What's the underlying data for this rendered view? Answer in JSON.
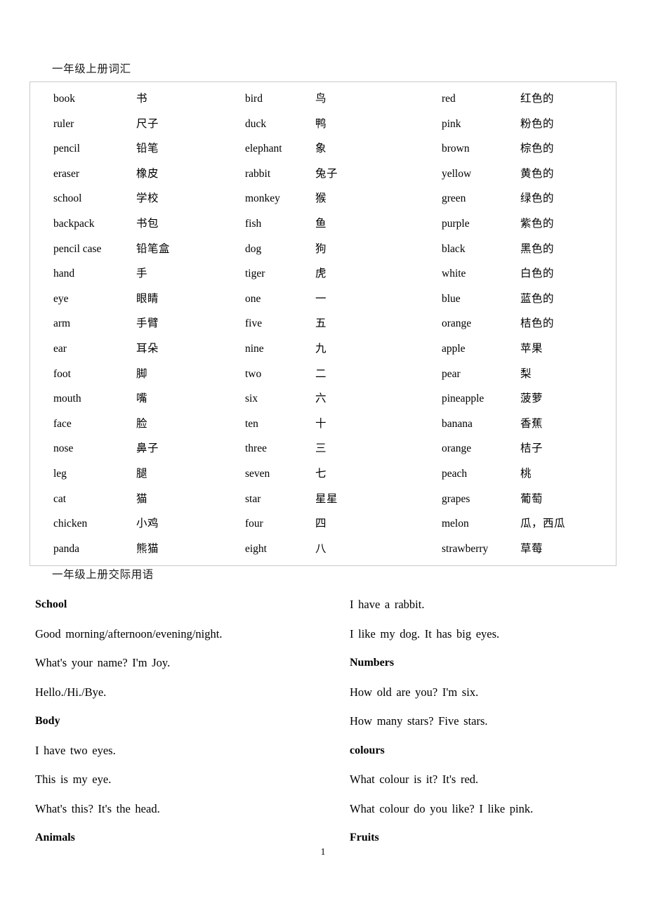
{
  "document": {
    "vocab_heading": "一年级上册词汇",
    "phrases_heading": "一年级上册交际用语",
    "page_number": "1"
  },
  "vocabulary": {
    "columns": [
      {
        "name": "column-1",
        "rows": [
          {
            "en": "book",
            "cn": "书"
          },
          {
            "en": "ruler",
            "cn": "尺子"
          },
          {
            "en": "pencil",
            "cn": "铅笔"
          },
          {
            "en": "eraser",
            "cn": "橡皮"
          },
          {
            "en": "school",
            "cn": "学校"
          },
          {
            "en": "backpack",
            "cn": "书包"
          },
          {
            "en": "pencil case",
            "cn": "铅笔盒"
          },
          {
            "en": "hand",
            "cn": "手"
          },
          {
            "en": "eye",
            "cn": "眼睛"
          },
          {
            "en": "arm",
            "cn": "手臂"
          },
          {
            "en": "ear",
            "cn": "耳朵"
          },
          {
            "en": "foot",
            "cn": "脚"
          },
          {
            "en": "mouth",
            "cn": "嘴"
          },
          {
            "en": "face",
            "cn": "脸"
          },
          {
            "en": "nose",
            "cn": "鼻子"
          },
          {
            "en": "leg",
            "cn": "腿"
          },
          {
            "en": "cat",
            "cn": "猫"
          },
          {
            "en": "chicken",
            "cn": "小鸡"
          },
          {
            "en": "panda",
            "cn": "熊猫"
          }
        ]
      },
      {
        "name": "column-2",
        "rows": [
          {
            "en": "bird",
            "cn": "鸟"
          },
          {
            "en": "duck",
            "cn": "鸭"
          },
          {
            "en": "elephant",
            "cn": "象"
          },
          {
            "en": "rabbit",
            "cn": "兔子"
          },
          {
            "en": "monkey",
            "cn": "猴"
          },
          {
            "en": "fish",
            "cn": "鱼"
          },
          {
            "en": "dog",
            "cn": "狗"
          },
          {
            "en": "tiger",
            "cn": "虎"
          },
          {
            "en": "one",
            "cn": "一"
          },
          {
            "en": "five",
            "cn": "五"
          },
          {
            "en": "nine",
            "cn": "九"
          },
          {
            "en": "two",
            "cn": "二"
          },
          {
            "en": "six",
            "cn": "六"
          },
          {
            "en": "ten",
            "cn": "十"
          },
          {
            "en": "three",
            "cn": "三"
          },
          {
            "en": "seven",
            "cn": "七"
          },
          {
            "en": "star",
            "cn": "星星"
          },
          {
            "en": "four",
            "cn": "四"
          },
          {
            "en": "eight",
            "cn": "八"
          }
        ]
      },
      {
        "name": "column-3",
        "rows": [
          {
            "en": "red",
            "cn": "红色的"
          },
          {
            "en": "pink",
            "cn": "粉色的"
          },
          {
            "en": "brown",
            "cn": "棕色的"
          },
          {
            "en": "yellow",
            "cn": "黄色的"
          },
          {
            "en": "green",
            "cn": "绿色的"
          },
          {
            "en": "purple",
            "cn": "紫色的"
          },
          {
            "en": "black",
            "cn": "黑色的"
          },
          {
            "en": "white",
            "cn": "白色的"
          },
          {
            "en": "blue",
            "cn": "蓝色的"
          },
          {
            "en": "orange",
            "cn": "桔色的"
          },
          {
            "en": "apple",
            "cn": "苹果"
          },
          {
            "en": "pear",
            "cn": "梨"
          },
          {
            "en": "pineapple",
            "cn": "菠萝"
          },
          {
            "en": "banana",
            "cn": "香蕉"
          },
          {
            "en": "orange",
            "cn": "桔子"
          },
          {
            "en": "peach",
            "cn": "桃"
          },
          {
            "en": "grapes",
            "cn": "葡萄"
          },
          {
            "en": "melon",
            "cn": "瓜，西瓜"
          },
          {
            "en": "strawberry",
            "cn": "草莓"
          }
        ]
      }
    ]
  },
  "phrases": {
    "left_column": [
      {
        "type": "head",
        "text": "School"
      },
      {
        "type": "sent",
        "text": "Good morning/afternoon/evening/night."
      },
      {
        "type": "sent",
        "text": "What's your name? I'm Joy."
      },
      {
        "type": "sent",
        "text": "Hello./Hi./Bye."
      },
      {
        "type": "head",
        "text": "Body"
      },
      {
        "type": "sent",
        "text": "I have two eyes."
      },
      {
        "type": "sent",
        "text": "This is my eye."
      },
      {
        "type": "sent",
        "text": "What's this? It's the head."
      },
      {
        "type": "head",
        "text": "Animals"
      }
    ],
    "right_column": [
      {
        "type": "sent",
        "text": "I have a rabbit."
      },
      {
        "type": "sent",
        "text": "I like my dog. It has big eyes."
      },
      {
        "type": "head",
        "text": "Numbers"
      },
      {
        "type": "sent",
        "text": "How old are you? I'm six."
      },
      {
        "type": "sent",
        "text": "How many stars? Five stars."
      },
      {
        "type": "head",
        "text": "colours"
      },
      {
        "type": "sent",
        "text": "What colour is it? It's red."
      },
      {
        "type": "sent",
        "text": "What colour do you like? I like pink."
      },
      {
        "type": "head",
        "text": "Fruits"
      }
    ]
  }
}
